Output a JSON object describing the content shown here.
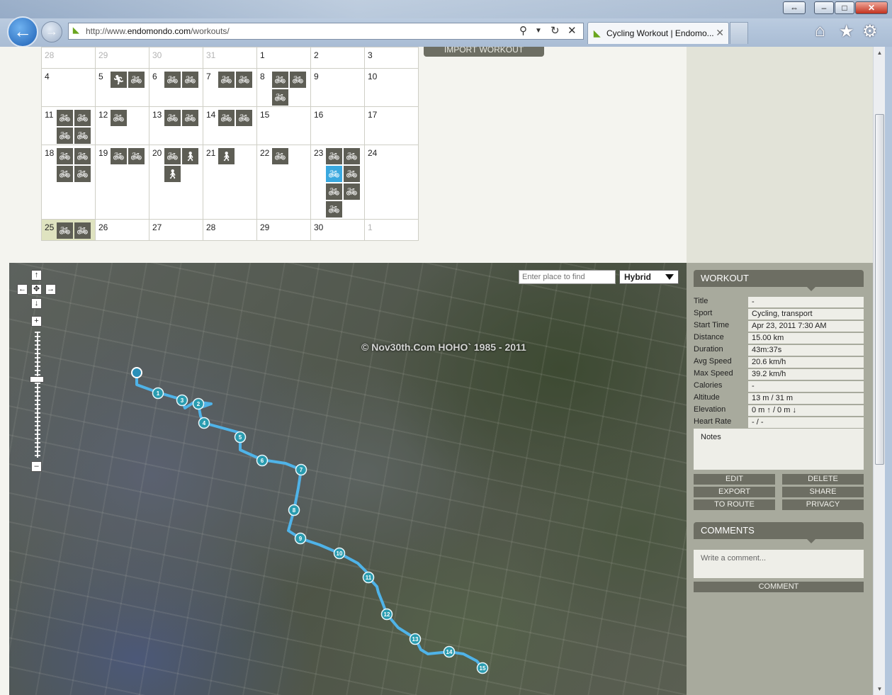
{
  "browser": {
    "url_prefix": "http://www.",
    "url_domain": "endomondo.com",
    "url_path": "/workouts/",
    "tab_title": "Cycling Workout | Endomo...",
    "icons": {
      "back": "back-arrow-icon",
      "forward": "forward-arrow-icon",
      "search": "search-icon",
      "refresh": "refresh-icon",
      "stop": "stop-icon",
      "home": "home-icon",
      "favorites": "star-icon",
      "tools": "gear-icon"
    }
  },
  "calendar": {
    "import_label": "IMPORT WORKOUT",
    "weeks": [
      {
        "cls": "first",
        "days": [
          {
            "n": "28",
            "dim": true,
            "w": []
          },
          {
            "n": "29",
            "dim": true,
            "w": []
          },
          {
            "n": "30",
            "dim": true,
            "w": []
          },
          {
            "n": "31",
            "dim": true,
            "w": []
          },
          {
            "n": "1",
            "w": []
          },
          {
            "n": "2",
            "w": []
          },
          {
            "n": "3",
            "w": []
          }
        ]
      },
      {
        "cls": "",
        "days": [
          {
            "n": "4",
            "w": []
          },
          {
            "n": "5",
            "w": [
              "run",
              "bike"
            ]
          },
          {
            "n": "6",
            "w": [
              "bike",
              "bike"
            ]
          },
          {
            "n": "7",
            "w": [
              "bike",
              "bike"
            ]
          },
          {
            "n": "8",
            "w": [
              "bike",
              "bike",
              "bike"
            ]
          },
          {
            "n": "9",
            "w": []
          },
          {
            "n": "10",
            "w": []
          }
        ]
      },
      {
        "cls": "",
        "days": [
          {
            "n": "11",
            "w": [
              "bike",
              "bike",
              "bike",
              "bike"
            ]
          },
          {
            "n": "12",
            "w": [
              "bike"
            ]
          },
          {
            "n": "13",
            "w": [
              "bike",
              "bike"
            ]
          },
          {
            "n": "14",
            "w": [
              "bike",
              "bike"
            ]
          },
          {
            "n": "15",
            "w": []
          },
          {
            "n": "16",
            "w": []
          },
          {
            "n": "17",
            "w": []
          }
        ]
      },
      {
        "cls": "tall",
        "days": [
          {
            "n": "18",
            "w": [
              "bike",
              "bike",
              "bike",
              "bike"
            ]
          },
          {
            "n": "19",
            "w": [
              "bike",
              "bike"
            ]
          },
          {
            "n": "20",
            "w": [
              "bike",
              "walk",
              "walk"
            ]
          },
          {
            "n": "21",
            "w": [
              "walk"
            ]
          },
          {
            "n": "22",
            "w": [
              "bike"
            ]
          },
          {
            "n": "23",
            "w": [
              "bike",
              "bike",
              "bike-sel",
              "bike",
              "bike",
              "bike",
              "bike"
            ]
          },
          {
            "n": "24",
            "w": []
          }
        ]
      },
      {
        "cls": "short",
        "days": [
          {
            "n": "25",
            "today": true,
            "w": [
              "bike",
              "bike"
            ]
          },
          {
            "n": "26",
            "w": []
          },
          {
            "n": "27",
            "w": []
          },
          {
            "n": "28",
            "w": []
          },
          {
            "n": "29",
            "w": []
          },
          {
            "n": "30",
            "w": []
          },
          {
            "n": "1",
            "dim": true,
            "w": []
          }
        ]
      }
    ]
  },
  "map": {
    "search_placeholder": "Enter place to find",
    "map_type": "Hybrid",
    "watermark": "© Nov30th.Com HOHO` 1985 - 2011",
    "route_color": "#4fb3e8",
    "markers": [
      "1",
      "2",
      "3",
      "4",
      "5",
      "6",
      "7",
      "8",
      "9",
      "10",
      "11",
      "12",
      "13",
      "14",
      "15"
    ]
  },
  "workout": {
    "header": "WORKOUT",
    "fields": [
      {
        "label": "Title",
        "value": "-"
      },
      {
        "label": "Sport",
        "value": "Cycling, transport"
      },
      {
        "label": "Start Time",
        "value": "Apr 23, 2011 7:30 AM"
      },
      {
        "label": "Distance",
        "value": "15.00 km"
      },
      {
        "label": "Duration",
        "value": "43m:37s"
      },
      {
        "label": "Avg Speed",
        "value": "20.6 km/h"
      },
      {
        "label": "Max Speed",
        "value": "39.2 km/h"
      },
      {
        "label": "Calories",
        "value": "-"
      },
      {
        "label": "Altitude",
        "value": "13 m / 31 m"
      },
      {
        "label": "Elevation",
        "value": "0 m ↑ / 0 m ↓"
      },
      {
        "label": "Heart Rate",
        "value": "- / -"
      }
    ],
    "notes_label": "Notes",
    "buttons": {
      "edit": "EDIT",
      "delete": "DELETE",
      "export": "EXPORT",
      "share": "SHARE",
      "to_route": "TO ROUTE",
      "privacy": "PRIVACY"
    }
  },
  "comments": {
    "header": "COMMENTS",
    "placeholder": "Write a comment...",
    "button": "COMMENT"
  }
}
